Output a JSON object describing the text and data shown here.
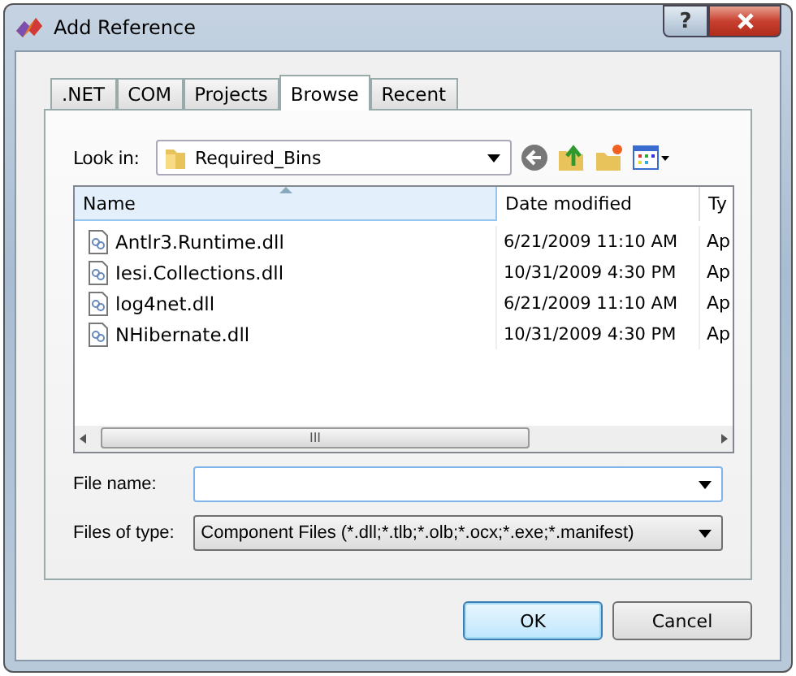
{
  "window": {
    "title": "Add Reference"
  },
  "tabs": [
    {
      "label": ".NET",
      "selected": false
    },
    {
      "label": "COM",
      "selected": false
    },
    {
      "label": "Projects",
      "selected": false
    },
    {
      "label": "Browse",
      "selected": true
    },
    {
      "label": "Recent",
      "selected": false
    }
  ],
  "look_in": {
    "label": "Look in:",
    "value": "Required_Bins"
  },
  "file_list": {
    "columns": [
      "Name",
      "Date modified",
      "Ty"
    ],
    "rows": [
      {
        "name": "Antlr3.Runtime.dll",
        "date_modified": "6/21/2009 11:10 AM",
        "column_3": "Ap"
      },
      {
        "name": "Iesi.Collections.dll",
        "date_modified": "10/31/2009 4:30 PM",
        "column_3": "Ap"
      },
      {
        "name": "log4net.dll",
        "date_modified": "6/21/2009 11:10 AM",
        "column_3": "Ap"
      },
      {
        "name": "NHibernate.dll",
        "date_modified": "10/31/2009 4:30 PM",
        "column_3": "Ap"
      }
    ],
    "scroll_grip": "III"
  },
  "file_name": {
    "label": "File name:"
  },
  "files_of_type": {
    "label": "Files of type:",
    "value": "Component Files (*.dll;*.tlb;*.olb;*.ocx;*.exe;*.manifest)"
  },
  "buttons": [
    {
      "label": "OK",
      "default": true
    },
    {
      "label": "Cancel",
      "default": false
    }
  ],
  "title_buttons": [
    "?"
  ]
}
